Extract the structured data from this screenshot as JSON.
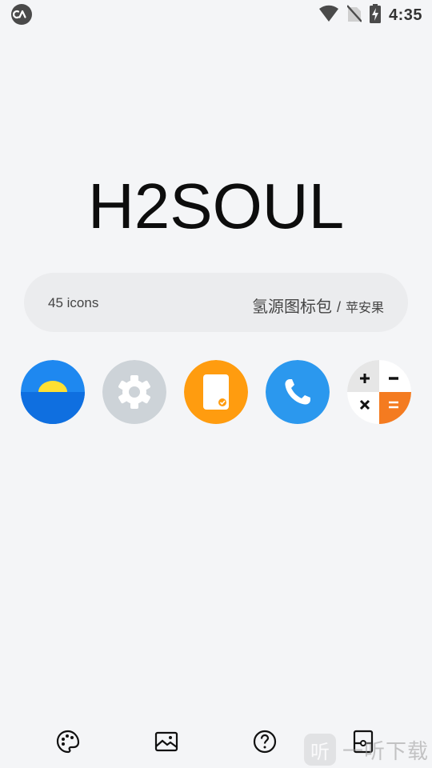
{
  "status_bar": {
    "time": "4:35",
    "icons": [
      "app-notification-icon",
      "wifi-icon",
      "no-sim-icon",
      "battery-charging-icon"
    ]
  },
  "header": {
    "title": "H2SOUL"
  },
  "info_bar": {
    "icon_count": "45 icons",
    "pack_name": "氢源图标包",
    "separator": "/",
    "author": "苹安果"
  },
  "preview_icons": [
    {
      "name": "weather-icon",
      "colors": [
        "#1e88f0",
        "#ffe033"
      ]
    },
    {
      "name": "settings-icon",
      "colors": [
        "#cdd3d8",
        "#ffffff"
      ]
    },
    {
      "name": "tablet-app-icon",
      "colors": [
        "#ff9c0f",
        "#ffffff"
      ]
    },
    {
      "name": "phone-icon",
      "colors": [
        "#2b98ee",
        "#ffffff"
      ]
    },
    {
      "name": "calculator-icon",
      "colors": [
        "#ffffff",
        "#e6e6e6",
        "#f47b20"
      ]
    }
  ],
  "bottom_nav": [
    {
      "name": "themes-palette-icon"
    },
    {
      "name": "wallpapers-icon"
    },
    {
      "name": "help-icon"
    },
    {
      "name": "icon-request-icon"
    }
  ],
  "watermark": {
    "glyph": "听",
    "text": "一听下载"
  }
}
